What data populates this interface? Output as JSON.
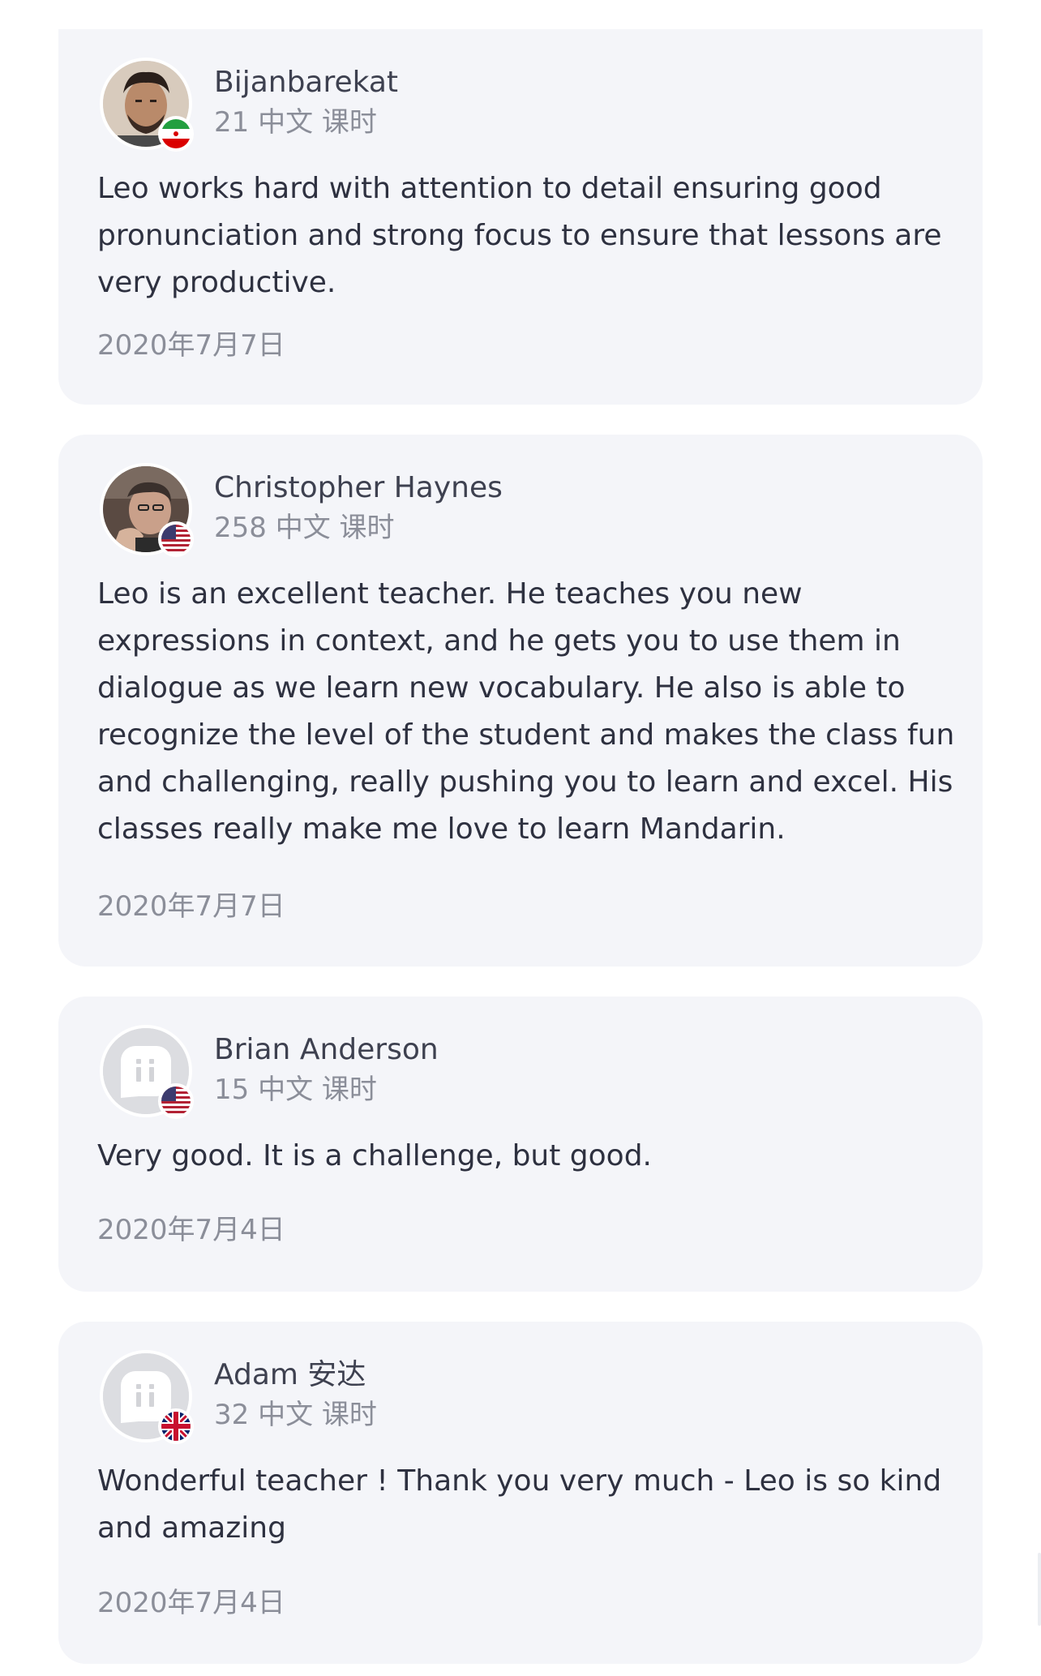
{
  "reviews": [
    {
      "name": "Bijanbarekat",
      "lessons": "21 中文 课时",
      "text": "Leo works hard with attention to detail ensuring good pronunciation and strong focus to ensure that lessons are very productive.",
      "date": "2020年7月7日",
      "avatar_icon": "user-photo",
      "flag_icon": "iran-flag-icon"
    },
    {
      "name": "Christopher Haynes",
      "lessons": "258 中文 课时",
      "text": "Leo is an excellent teacher. He teaches you new expressions in context, and he gets you to use them in dialogue as we learn new vocabulary. He also is able to recognize the level of the student and makes the class fun and challenging, really pushing you to learn and excel. His classes really make me love to learn Mandarin.",
      "date": "2020年7月7日",
      "avatar_icon": "user-photo",
      "flag_icon": "usa-flag-icon"
    },
    {
      "name": "Brian Anderson",
      "lessons": "15 中文 课时",
      "text": "Very good. It is a challenge, but good.",
      "date": "2020年7月4日",
      "avatar_icon": "default-avatar-icon",
      "flag_icon": "usa-flag-icon"
    },
    {
      "name": "Adam 安达",
      "lessons": "32 中文 课时",
      "text": "Wonderful teacher ! Thank you very much - Leo is so kind and amazing",
      "date": "2020年7月4日",
      "avatar_icon": "default-avatar-icon",
      "flag_icon": "uk-flag-icon"
    }
  ],
  "colors": {
    "card_bg": "#f4f5f9",
    "name": "#3e4150",
    "secondary": "#8b8e99",
    "body_text": "#2e3140",
    "avatar_placeholder": "#dcdde1"
  }
}
